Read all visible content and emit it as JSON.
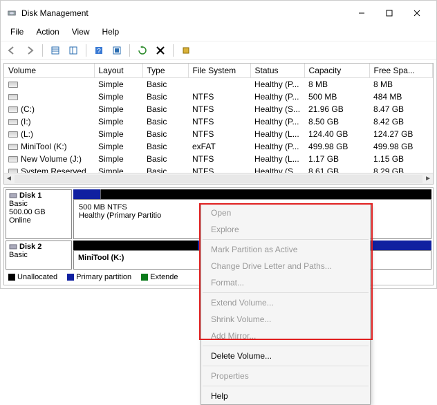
{
  "window": {
    "title": "Disk Management"
  },
  "menubar": [
    "File",
    "Action",
    "View",
    "Help"
  ],
  "columns": [
    "Volume",
    "Layout",
    "Type",
    "File System",
    "Status",
    "Capacity",
    "Free Spa..."
  ],
  "col_widths": [
    "130px",
    "70px",
    "66px",
    "90px",
    "66px",
    "94px",
    "auto"
  ],
  "rows": [
    {
      "vol": "",
      "layout": "Simple",
      "type": "Basic",
      "fs": "",
      "status": "Healthy (P...",
      "cap": "8 MB",
      "free": "8 MB"
    },
    {
      "vol": "",
      "layout": "Simple",
      "type": "Basic",
      "fs": "NTFS",
      "status": "Healthy (P...",
      "cap": "500 MB",
      "free": "484 MB"
    },
    {
      "vol": "(C:)",
      "layout": "Simple",
      "type": "Basic",
      "fs": "NTFS",
      "status": "Healthy (S...",
      "cap": "21.96 GB",
      "free": "8.47 GB"
    },
    {
      "vol": "(I:)",
      "layout": "Simple",
      "type": "Basic",
      "fs": "NTFS",
      "status": "Healthy (P...",
      "cap": "8.50 GB",
      "free": "8.42 GB"
    },
    {
      "vol": "(L:)",
      "layout": "Simple",
      "type": "Basic",
      "fs": "NTFS",
      "status": "Healthy (L...",
      "cap": "124.40 GB",
      "free": "124.27 GB"
    },
    {
      "vol": "MiniTool (K:)",
      "layout": "Simple",
      "type": "Basic",
      "fs": "exFAT",
      "status": "Healthy (P...",
      "cap": "499.98 GB",
      "free": "499.98 GB"
    },
    {
      "vol": "New Volume (J:)",
      "layout": "Simple",
      "type": "Basic",
      "fs": "NTFS",
      "status": "Healthy (L...",
      "cap": "1.17 GB",
      "free": "1.15 GB"
    },
    {
      "vol": "System Reserved",
      "layout": "Simple",
      "type": "Basic",
      "fs": "NTFS",
      "status": "Healthy (S...",
      "cap": "8.61 GB",
      "free": "8.29 GB"
    }
  ],
  "disk1": {
    "name": "Disk 1",
    "type": "Basic",
    "size": "500.00 GB",
    "status": "Online",
    "part_line1": "500 MB NTFS",
    "part_line2": "Healthy (Primary Partitio"
  },
  "disk2": {
    "name": "Disk 2",
    "type": "Basic",
    "label": "MiniTool (K:)"
  },
  "legend": {
    "unallocated": "Unallocated",
    "primary": "Primary partition",
    "extended": "Extende"
  },
  "context_menu": [
    {
      "t": "Open",
      "en": false
    },
    {
      "t": "Explore",
      "en": false
    },
    "-",
    {
      "t": "Mark Partition as Active",
      "en": false
    },
    {
      "t": "Change Drive Letter and Paths...",
      "en": false
    },
    {
      "t": "Format...",
      "en": false
    },
    "-",
    {
      "t": "Extend Volume...",
      "en": false
    },
    {
      "t": "Shrink Volume...",
      "en": false
    },
    {
      "t": "Add Mirror...",
      "en": false
    },
    "-",
    {
      "t": "Delete Volume...",
      "en": true
    },
    "-",
    {
      "t": "Properties",
      "en": false
    },
    "-",
    {
      "t": "Help",
      "en": true
    }
  ]
}
